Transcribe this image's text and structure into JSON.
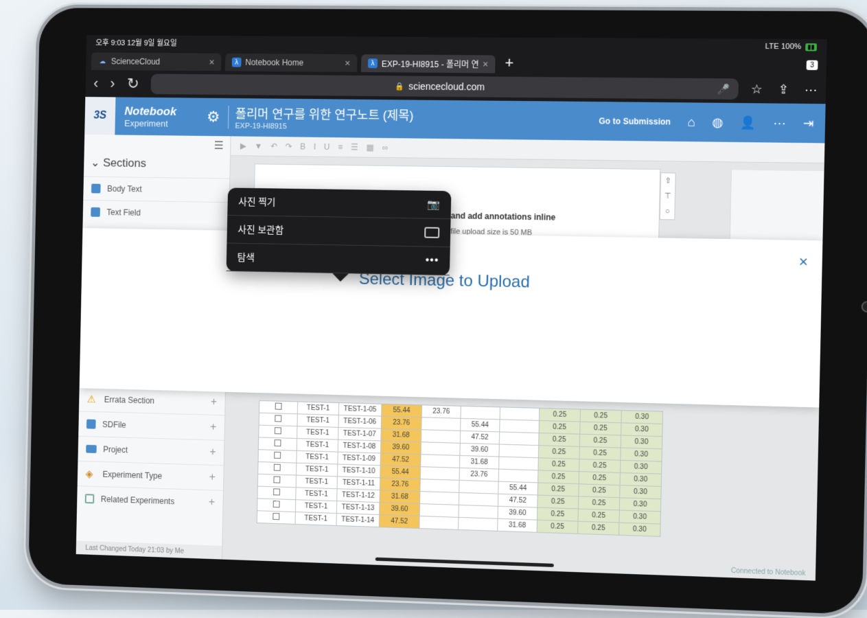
{
  "status": {
    "time_date": "오후 9:03  12월 9일 월요일",
    "network": "LTE 100%"
  },
  "tabs": [
    {
      "title": "ScienceCloud"
    },
    {
      "title": "Notebook Home"
    },
    {
      "title": "EXP-19-HI8915 - 폴리머 연"
    }
  ],
  "tab_count": "3",
  "url": "sciencecloud.com",
  "app": {
    "logo": "3S",
    "brand_title": "Notebook",
    "brand_sub": "Experiment",
    "doc_title": "폴리머 연구를 위한 연구노트 (제목)",
    "doc_id": "EXP-19-HI8915",
    "goto_label": "Go to Submission"
  },
  "sidebar": {
    "sections_label": "Sections",
    "items": [
      {
        "label": "Body Text"
      },
      {
        "label": "Text Field"
      }
    ],
    "lower_items": [
      {
        "label": "Errata Section"
      },
      {
        "label": "SDFile"
      },
      {
        "label": "Project"
      },
      {
        "label": "Experiment Type"
      },
      {
        "label": "Related Experiments"
      }
    ],
    "footer": "Last Changed Today 21:03 by Me"
  },
  "editor": {
    "line1": "and add annotations inline",
    "line2": "file upload size is 50 MB"
  },
  "grid_rows": [
    [
      "TEST-1",
      "TEST-1-05",
      "55.44",
      "23.76",
      "",
      "",
      "0.25",
      "0.25",
      "0.30"
    ],
    [
      "TEST-1",
      "TEST-1-06",
      "23.76",
      "",
      "55.44",
      "",
      "0.25",
      "0.25",
      "0.30"
    ],
    [
      "TEST-1",
      "TEST-1-07",
      "31.68",
      "",
      "47.52",
      "",
      "0.25",
      "0.25",
      "0.30"
    ],
    [
      "TEST-1",
      "TEST-1-08",
      "39.60",
      "",
      "39.60",
      "",
      "0.25",
      "0.25",
      "0.30"
    ],
    [
      "TEST-1",
      "TEST-1-09",
      "47.52",
      "",
      "31.68",
      "",
      "0.25",
      "0.25",
      "0.30"
    ],
    [
      "TEST-1",
      "TEST-1-10",
      "55.44",
      "",
      "23.76",
      "",
      "0.25",
      "0.25",
      "0.30"
    ],
    [
      "TEST-1",
      "TEST-1-11",
      "23.76",
      "",
      "",
      "55.44",
      "0.25",
      "0.25",
      "0.30"
    ],
    [
      "TEST-1",
      "TEST-1-12",
      "31.68",
      "",
      "",
      "47.52",
      "0.25",
      "0.25",
      "0.30"
    ],
    [
      "TEST-1",
      "TEST-1-13",
      "39.60",
      "",
      "",
      "39.60",
      "0.25",
      "0.25",
      "0.30"
    ],
    [
      "TEST-1",
      "TEST-1-14",
      "47.52",
      "",
      "",
      "31.68",
      "0.25",
      "0.25",
      "0.30"
    ]
  ],
  "connected": "Connected to Notebook",
  "modal": {
    "title": "Select Image to Upload",
    "close": "×"
  },
  "popover": [
    {
      "label": "사진 찍기",
      "icon": "camera-icon"
    },
    {
      "label": "사진 보관함",
      "icon": "photo-library-icon"
    },
    {
      "label": "탐색",
      "icon": "more-icon"
    }
  ]
}
